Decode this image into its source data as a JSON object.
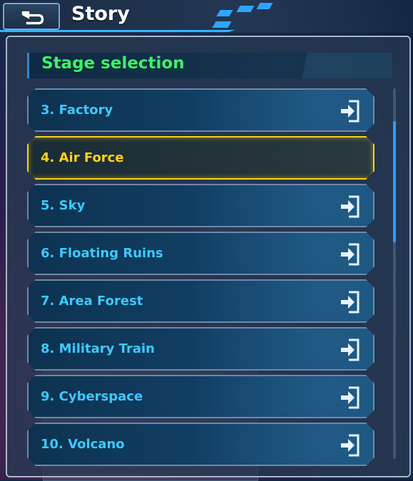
{
  "header": {
    "title": "Story",
    "back_icon": "back-arrow-icon"
  },
  "panel": {
    "section_title": "Stage selection"
  },
  "stages": [
    {
      "label": "3. Factory",
      "selected": false
    },
    {
      "label": "4. Air Force",
      "selected": true
    },
    {
      "label": "5. Sky",
      "selected": false
    },
    {
      "label": "6. Floating Ruins",
      "selected": false
    },
    {
      "label": "7. Area Forest",
      "selected": false
    },
    {
      "label": "8. Military Train",
      "selected": false
    },
    {
      "label": "9. Cyberspace",
      "selected": false
    },
    {
      "label": "10. Volcano",
      "selected": false
    }
  ],
  "colors": {
    "accent_blue": "#3fc8ff",
    "selected_yellow": "#ffd21a",
    "section_green": "#3df26c"
  }
}
